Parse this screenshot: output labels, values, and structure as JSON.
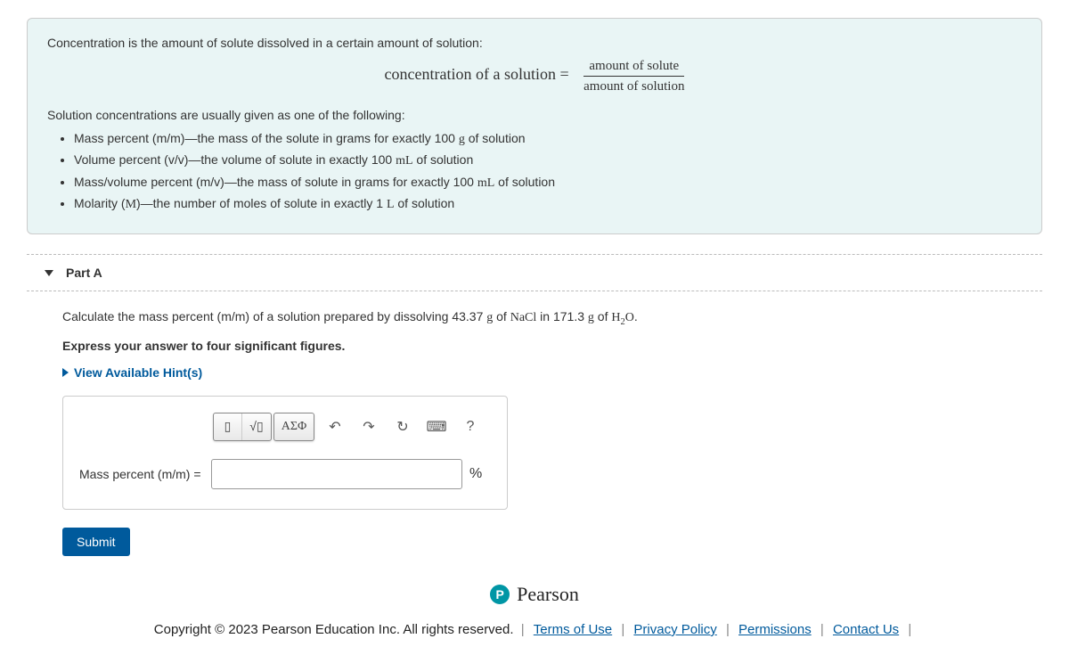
{
  "intro": {
    "line1": "Concentration is the amount of solute dissolved in a certain amount of solution:",
    "formula_lhs": "concentration of a solution =",
    "formula_num": "amount of solute",
    "formula_den": "amount of solution",
    "line2": "Solution concentrations are usually given as one of the following:",
    "bullets": {
      "b1_a": "Mass percent (m/m)—the mass of the solute in grams for exactly 100 ",
      "b1_b": "g",
      "b1_c": " of solution",
      "b2_a": "Volume percent (v/v)—the volume of solute in exactly 100 ",
      "b2_b": "mL",
      "b2_c": " of solution",
      "b3_a": "Mass/volume percent (m/v)—the mass of solute in grams for exactly 100 ",
      "b3_b": "mL",
      "b3_c": " of solution",
      "b4_a": "Molarity (",
      "b4_b": "M",
      "b4_c": ")—the number of moles of solute in exactly 1 ",
      "b4_d": "L",
      "b4_e": " of solution"
    }
  },
  "part": {
    "title": "Part A",
    "q1": "Calculate the mass percent (m/m) of a solution prepared by dissolving 43.37 ",
    "q_g1": "g",
    "q_of": " of ",
    "q_nacl": "NaCl",
    "q_in": " in 171.3 ",
    "q_g2": "g",
    "q_of2": " of ",
    "q_h2o_h": "H",
    "q_h2o_2": "2",
    "q_h2o_o": "O",
    "q_end": ".",
    "instruct": "Express your answer to four significant figures.",
    "hints": "View Available Hint(s)",
    "answer_label": "Mass percent (m/m) =",
    "answer_value": "",
    "unit": "%",
    "toolbar": {
      "template": "▯",
      "radical": "√▯",
      "greek": "ΑΣΦ",
      "undo": "↶",
      "redo": "↷",
      "reset": "↻",
      "keyboard": "⌨",
      "help": "?"
    },
    "submit": "Submit"
  },
  "footer": {
    "brand_letter": "P",
    "brand": "Pearson",
    "copyright": "Copyright © 2023 Pearson Education Inc. All rights reserved.",
    "links": {
      "terms": "Terms of Use",
      "privacy": "Privacy Policy",
      "permissions": "Permissions",
      "contact": "Contact Us"
    }
  }
}
